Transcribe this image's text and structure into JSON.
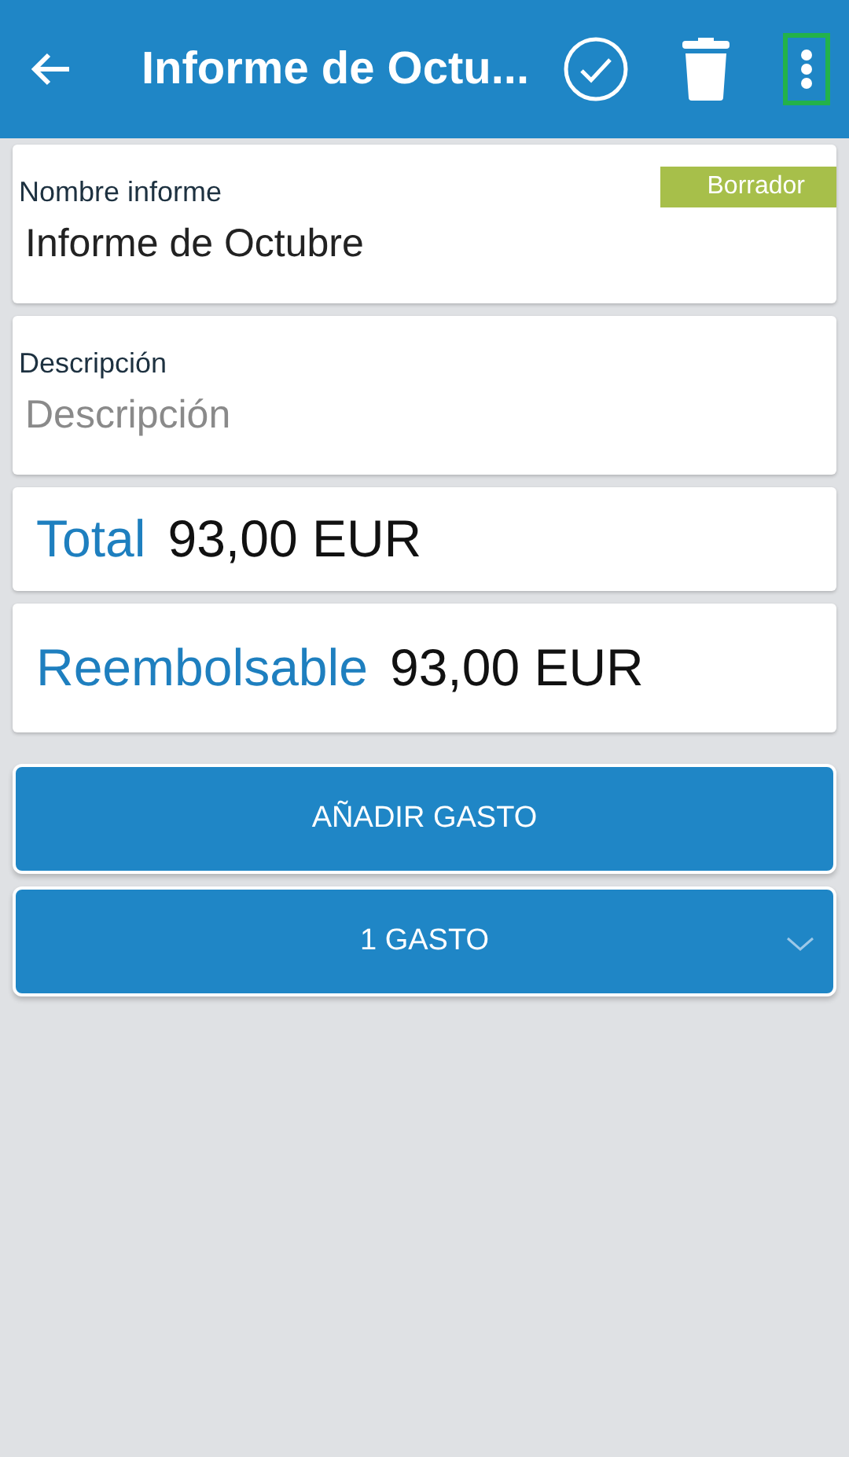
{
  "app_bar": {
    "title": "Informe de Octu...",
    "menu_highlighted": true
  },
  "name_field": {
    "label": "Nombre informe",
    "value": "Informe de Octubre",
    "status": "Borrador"
  },
  "description_field": {
    "label": "Descripción",
    "placeholder": "Descripción"
  },
  "totals": [
    {
      "label": "Total",
      "amount": "93,00 EUR"
    },
    {
      "label": "Reembolsable",
      "amount": "93,00 EUR"
    }
  ],
  "add_button": "AÑADIR GASTO",
  "expenses_toggle": {
    "label": "1 GASTO",
    "expanded": false
  }
}
